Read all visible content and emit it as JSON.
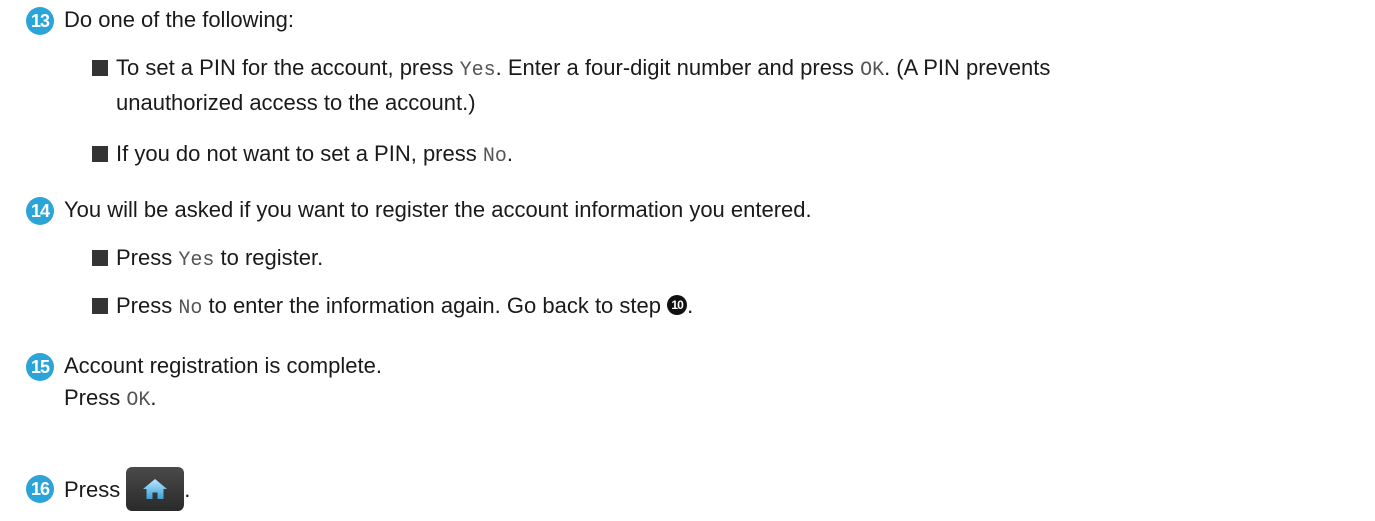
{
  "steps": [
    {
      "num": "13",
      "text": "Do one of the following:",
      "bullets": [
        {
          "parts": [
            {
              "t": "To set a PIN for the account, press "
            },
            {
              "m": "Yes"
            },
            {
              "t": ". Enter a four-digit number and press "
            },
            {
              "m": "OK"
            },
            {
              "t": ". (A PIN prevents"
            }
          ],
          "line2": "unauthorized access to the account.)"
        },
        {
          "parts": [
            {
              "t": "If you do not want to set a PIN, press "
            },
            {
              "m": "No"
            },
            {
              "t": "."
            }
          ]
        }
      ]
    },
    {
      "num": "14",
      "text": "You will be asked if you want to register the account information you entered.",
      "bullets": [
        {
          "parts": [
            {
              "t": "Press "
            },
            {
              "m": "Yes"
            },
            {
              "t": " to register."
            }
          ]
        },
        {
          "parts": [
            {
              "t": "Press "
            },
            {
              "m": "No"
            },
            {
              "t": " to enter the information again. Go back to step "
            }
          ],
          "ref": "10",
          "after_ref": "."
        }
      ]
    },
    {
      "num": "15",
      "text": "Account registration is complete.",
      "line2_prefix": "Press ",
      "line2_mono": "OK",
      "line2_suffix": "."
    },
    {
      "num": "16",
      "text": "Press",
      "icon": "home-icon",
      "suffix": "."
    }
  ],
  "colors": {
    "step_badge": "#2ba4d8",
    "text": "#1a1a1a",
    "mono": "#555555"
  }
}
